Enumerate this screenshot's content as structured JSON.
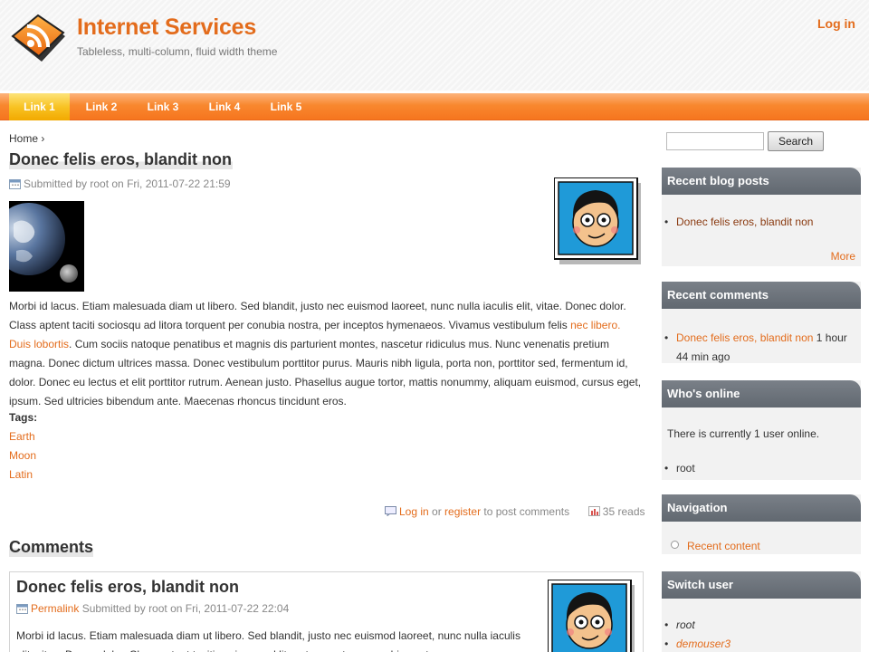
{
  "site": {
    "name": "Internet Services",
    "slogan": "Tableless, multi-column, fluid width theme",
    "login": "Log in"
  },
  "nav": [
    "Link 1",
    "Link 2",
    "Link 3",
    "Link 4",
    "Link 5"
  ],
  "breadcrumb": "Home ›",
  "node": {
    "title": "Donec felis eros, blandit non",
    "submitted": "Submitted by root on Fri, 2011-07-22 21:59",
    "body_part1": "Morbi id lacus. Etiam malesuada diam ut libero. Sed blandit, justo nec euismod laoreet, nunc nulla iaculis elit, vitae. Donec dolor. Class aptent taciti sociosqu ad litora torquent per conubia nostra, per inceptos hymenaeos. Vivamus vestibulum felis ",
    "body_highlight": "nec libero. Duis lobortis",
    "body_part2": ". Cum sociis natoque penatibus et magnis dis parturient montes, nascetur ridiculus mus. Nunc venenatis pretium magna. Donec dictum ultrices massa. Donec vestibulum porttitor purus. Mauris nibh ligula, porta non, porttitor sed, fermentum id, dolor. Donec eu lectus et elit porttitor rutrum. Aenean justo. Phasellus augue tortor, mattis nonummy, aliquam euismod, cursus eget, ipsum. Sed ultricies bibendum ante. Maecenas rhoncus tincidunt eros.",
    "tags_label": "Tags:",
    "tags": [
      "Earth",
      "Moon",
      "Latin"
    ],
    "links": {
      "login": "Log in",
      "or": " or ",
      "register": "register",
      "to_post": " to post comments",
      "reads": "35 reads"
    }
  },
  "comments": {
    "heading": "Comments",
    "first": {
      "title": "Donec felis eros, blandit non",
      "permalink": "Permalink",
      "submitted": " Submitted by root on Fri, 2011-07-22 22:04",
      "text": "Morbi id lacus. Etiam malesuada diam ut libero. Sed blandit, justo nec euismod laoreet, nunc nulla iaculis elit, vitae. Donec dolor. Class aptent taciti sociosqu ad litora torquent per conubia nostra, per"
    }
  },
  "sidebar": {
    "search_button": "Search",
    "recent_posts": {
      "title": "Recent blog posts",
      "items": [
        "Donec felis eros, blandit non"
      ],
      "more": "More"
    },
    "recent_comments": {
      "title": "Recent comments",
      "link": "Donec felis eros, blandit non",
      "time_a": " 1 hour",
      "time_b": "44 min ago"
    },
    "whos_online": {
      "title": "Who's online",
      "text": "There is currently 1 user online.",
      "users": [
        "root"
      ]
    },
    "navigation": {
      "title": "Navigation",
      "items": [
        "Recent content"
      ]
    },
    "switch_user": {
      "title": "Switch user",
      "users": [
        "root",
        "demouser3"
      ]
    }
  }
}
